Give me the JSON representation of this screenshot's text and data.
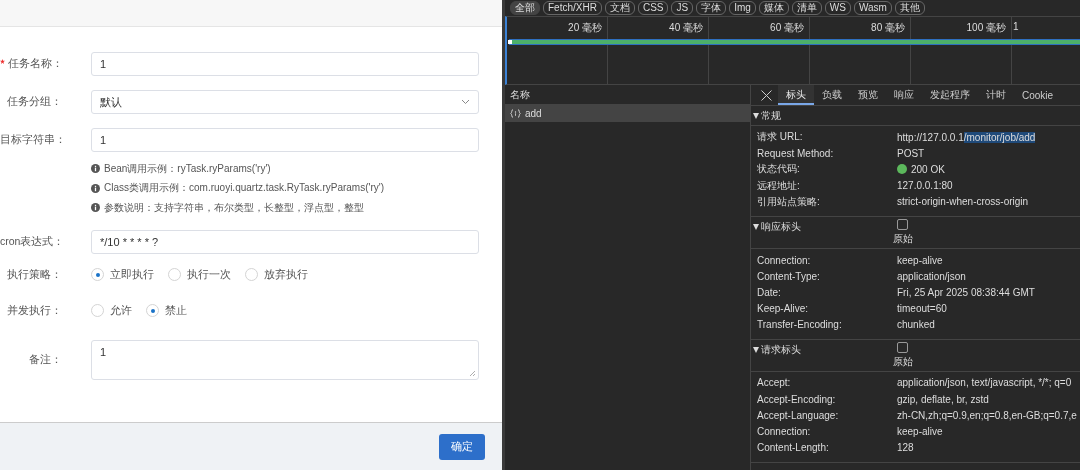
{
  "dialog": {
    "fields": [
      {
        "kind": "input",
        "label": "任务名称：",
        "required": true,
        "value": "1"
      },
      {
        "kind": "select",
        "label": "任务分组：",
        "required": false,
        "value": "默认"
      },
      {
        "kind": "input",
        "label": "目标字符串：",
        "required": false,
        "value": "1",
        "hints": [
          "Bean调用示例：ryTask.ryParams('ry')",
          "Class类调用示例：com.ruoyi.quartz.task.RyTask.ryParams('ry')",
          "参数说明：支持字符串，布尔类型，长整型，浮点型，整型"
        ]
      },
      {
        "kind": "input",
        "label": "cron表达式：",
        "required": false,
        "value": "*/10 * * * * ?"
      },
      {
        "kind": "radio",
        "label": "执行策略：",
        "required": false,
        "options": [
          {
            "label": "立即执行",
            "selected": true
          },
          {
            "label": "执行一次",
            "selected": false
          },
          {
            "label": "放弃执行",
            "selected": false
          }
        ]
      },
      {
        "kind": "radio",
        "label": "并发执行：",
        "required": false,
        "options": [
          {
            "label": "允许",
            "selected": false
          },
          {
            "label": "禁止",
            "selected": true
          }
        ]
      },
      {
        "kind": "textarea",
        "label": "备注：",
        "required": false,
        "value": "1"
      }
    ],
    "buttons": [
      "确定"
    ]
  },
  "devtools": {
    "filters": [
      {
        "label": "全部",
        "selected": true
      },
      {
        "label": "Fetch/XHR",
        "selected": false
      },
      {
        "label": "文档",
        "selected": false
      },
      {
        "label": "CSS",
        "selected": false
      },
      {
        "label": "JS",
        "selected": false
      },
      {
        "label": "字体",
        "selected": false
      },
      {
        "label": "Img",
        "selected": false
      },
      {
        "label": "媒体",
        "selected": false
      },
      {
        "label": "清单",
        "selected": false
      },
      {
        "label": "WS",
        "selected": false
      },
      {
        "label": "Wasm",
        "selected": false
      },
      {
        "label": "其他",
        "selected": false
      }
    ],
    "timeline": {
      "ticks": [
        "20 毫秒",
        "40 毫秒",
        "60 毫秒",
        "80 毫秒",
        "100 毫秒",
        "1"
      ]
    },
    "requests": {
      "header": "名称",
      "rows": [
        {
          "name": "add",
          "selected": true
        }
      ]
    },
    "detail": {
      "tabs": [
        {
          "label": "标头",
          "selected": true
        },
        {
          "label": "负载",
          "selected": false
        },
        {
          "label": "预览",
          "selected": false
        },
        {
          "label": "响应",
          "selected": false
        },
        {
          "label": "发起程序",
          "selected": false
        },
        {
          "label": "计时",
          "selected": false
        },
        {
          "label": "Cookie",
          "selected": false
        }
      ],
      "sections": [
        {
          "title": "常规",
          "expanded": true,
          "rows": [
            {
              "kind": "text",
              "name": "请求 URL:",
              "value": "http://127.0.0.1",
              "highlight": "/monitor/job/add"
            },
            {
              "kind": "text",
              "name": "Request Method:",
              "value": "POST"
            },
            {
              "kind": "status",
              "name": "状态代码:",
              "value": "200 OK"
            },
            {
              "kind": "text",
              "name": "远程地址:",
              "value": "127.0.0.1:80"
            },
            {
              "kind": "text",
              "name": "引用站点策略:",
              "value": "strict-origin-when-cross-origin"
            }
          ]
        },
        {
          "title": "响应标头",
          "expanded": true,
          "raw": {
            "label": "原始",
            "checked": false
          },
          "rows": [
            {
              "kind": "text",
              "name": "Connection:",
              "value": "keep-alive"
            },
            {
              "kind": "text",
              "name": "Content-Type:",
              "value": "application/json"
            },
            {
              "kind": "text",
              "name": "Date:",
              "value": "Fri, 25 Apr 2025 08:38:44 GMT"
            },
            {
              "kind": "text",
              "name": "Keep-Alive:",
              "value": "timeout=60"
            },
            {
              "kind": "text",
              "name": "Transfer-Encoding:",
              "value": "chunked"
            }
          ]
        },
        {
          "title": "请求标头",
          "expanded": true,
          "raw": {
            "label": "原始",
            "checked": false
          },
          "rows": [
            {
              "kind": "text",
              "name": "Accept:",
              "value": "application/json, text/javascript, */*; q=0"
            },
            {
              "kind": "text",
              "name": "Accept-Encoding:",
              "value": "gzip, deflate, br, zstd"
            },
            {
              "kind": "text",
              "name": "Accept-Language:",
              "value": "zh-CN,zh;q=0.9,en;q=0.8,en-GB;q=0.7,e"
            },
            {
              "kind": "text",
              "name": "Connection:",
              "value": "keep-alive"
            },
            {
              "kind": "text",
              "name": "Content-Length:",
              "value": "128"
            }
          ]
        }
      ]
    }
  }
}
